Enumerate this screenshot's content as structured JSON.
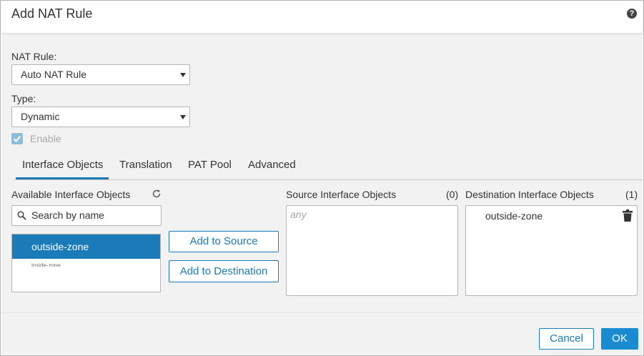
{
  "dialog": {
    "title": "Add NAT Rule",
    "help_icon": "help-icon"
  },
  "form": {
    "nat_rule_label": "NAT Rule:",
    "nat_rule_value": "Auto NAT Rule",
    "type_label": "Type:",
    "type_value": "Dynamic",
    "enable_label": "Enable",
    "enable_checked": true
  },
  "tabs": [
    {
      "label": "Interface Objects",
      "active": true
    },
    {
      "label": "Translation",
      "active": false
    },
    {
      "label": "PAT Pool",
      "active": false
    },
    {
      "label": "Advanced",
      "active": false
    }
  ],
  "available": {
    "title": "Available Interface Objects",
    "search_placeholder": "Search by name",
    "items": [
      {
        "label": "outside-zone",
        "selected": true
      },
      {
        "label": "inside-zone",
        "selected": false
      }
    ]
  },
  "actions": {
    "add_to_source": "Add to Source",
    "add_to_destination": "Add to Destination"
  },
  "source": {
    "title": "Source Interface Objects",
    "count": "(0)",
    "placeholder": "any"
  },
  "destination": {
    "title": "Destination Interface Objects",
    "count": "(1)",
    "items": [
      "outside-zone"
    ]
  },
  "footer": {
    "cancel": "Cancel",
    "ok": "OK"
  },
  "colors": {
    "accent": "#1a7bb8",
    "primary_button": "#1a8bd0",
    "panel_background": "#f2f2f2"
  }
}
